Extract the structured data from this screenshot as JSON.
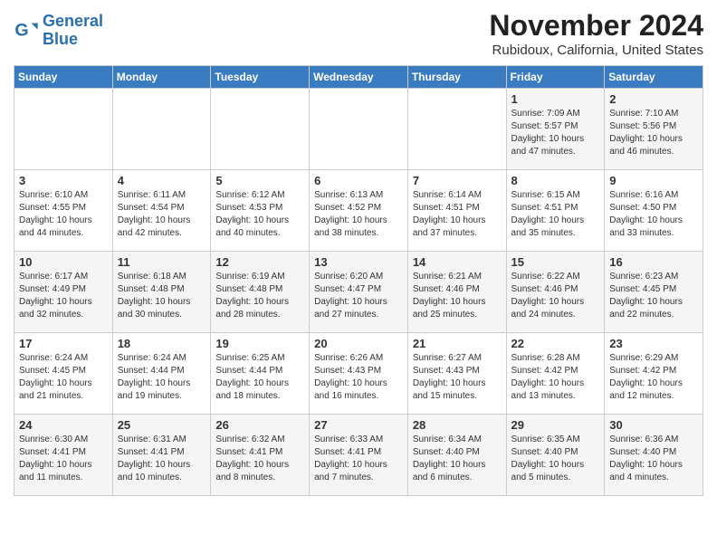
{
  "logo": {
    "line1": "General",
    "line2": "Blue"
  },
  "title": "November 2024",
  "location": "Rubidoux, California, United States",
  "days_of_week": [
    "Sunday",
    "Monday",
    "Tuesday",
    "Wednesday",
    "Thursday",
    "Friday",
    "Saturday"
  ],
  "weeks": [
    [
      {
        "day": "",
        "content": ""
      },
      {
        "day": "",
        "content": ""
      },
      {
        "day": "",
        "content": ""
      },
      {
        "day": "",
        "content": ""
      },
      {
        "day": "",
        "content": ""
      },
      {
        "day": "1",
        "content": "Sunrise: 7:09 AM\nSunset: 5:57 PM\nDaylight: 10 hours and 47 minutes."
      },
      {
        "day": "2",
        "content": "Sunrise: 7:10 AM\nSunset: 5:56 PM\nDaylight: 10 hours and 46 minutes."
      }
    ],
    [
      {
        "day": "3",
        "content": "Sunrise: 6:10 AM\nSunset: 4:55 PM\nDaylight: 10 hours and 44 minutes."
      },
      {
        "day": "4",
        "content": "Sunrise: 6:11 AM\nSunset: 4:54 PM\nDaylight: 10 hours and 42 minutes."
      },
      {
        "day": "5",
        "content": "Sunrise: 6:12 AM\nSunset: 4:53 PM\nDaylight: 10 hours and 40 minutes."
      },
      {
        "day": "6",
        "content": "Sunrise: 6:13 AM\nSunset: 4:52 PM\nDaylight: 10 hours and 38 minutes."
      },
      {
        "day": "7",
        "content": "Sunrise: 6:14 AM\nSunset: 4:51 PM\nDaylight: 10 hours and 37 minutes."
      },
      {
        "day": "8",
        "content": "Sunrise: 6:15 AM\nSunset: 4:51 PM\nDaylight: 10 hours and 35 minutes."
      },
      {
        "day": "9",
        "content": "Sunrise: 6:16 AM\nSunset: 4:50 PM\nDaylight: 10 hours and 33 minutes."
      }
    ],
    [
      {
        "day": "10",
        "content": "Sunrise: 6:17 AM\nSunset: 4:49 PM\nDaylight: 10 hours and 32 minutes."
      },
      {
        "day": "11",
        "content": "Sunrise: 6:18 AM\nSunset: 4:48 PM\nDaylight: 10 hours and 30 minutes."
      },
      {
        "day": "12",
        "content": "Sunrise: 6:19 AM\nSunset: 4:48 PM\nDaylight: 10 hours and 28 minutes."
      },
      {
        "day": "13",
        "content": "Sunrise: 6:20 AM\nSunset: 4:47 PM\nDaylight: 10 hours and 27 minutes."
      },
      {
        "day": "14",
        "content": "Sunrise: 6:21 AM\nSunset: 4:46 PM\nDaylight: 10 hours and 25 minutes."
      },
      {
        "day": "15",
        "content": "Sunrise: 6:22 AM\nSunset: 4:46 PM\nDaylight: 10 hours and 24 minutes."
      },
      {
        "day": "16",
        "content": "Sunrise: 6:23 AM\nSunset: 4:45 PM\nDaylight: 10 hours and 22 minutes."
      }
    ],
    [
      {
        "day": "17",
        "content": "Sunrise: 6:24 AM\nSunset: 4:45 PM\nDaylight: 10 hours and 21 minutes."
      },
      {
        "day": "18",
        "content": "Sunrise: 6:24 AM\nSunset: 4:44 PM\nDaylight: 10 hours and 19 minutes."
      },
      {
        "day": "19",
        "content": "Sunrise: 6:25 AM\nSunset: 4:44 PM\nDaylight: 10 hours and 18 minutes."
      },
      {
        "day": "20",
        "content": "Sunrise: 6:26 AM\nSunset: 4:43 PM\nDaylight: 10 hours and 16 minutes."
      },
      {
        "day": "21",
        "content": "Sunrise: 6:27 AM\nSunset: 4:43 PM\nDaylight: 10 hours and 15 minutes."
      },
      {
        "day": "22",
        "content": "Sunrise: 6:28 AM\nSunset: 4:42 PM\nDaylight: 10 hours and 13 minutes."
      },
      {
        "day": "23",
        "content": "Sunrise: 6:29 AM\nSunset: 4:42 PM\nDaylight: 10 hours and 12 minutes."
      }
    ],
    [
      {
        "day": "24",
        "content": "Sunrise: 6:30 AM\nSunset: 4:41 PM\nDaylight: 10 hours and 11 minutes."
      },
      {
        "day": "25",
        "content": "Sunrise: 6:31 AM\nSunset: 4:41 PM\nDaylight: 10 hours and 10 minutes."
      },
      {
        "day": "26",
        "content": "Sunrise: 6:32 AM\nSunset: 4:41 PM\nDaylight: 10 hours and 8 minutes."
      },
      {
        "day": "27",
        "content": "Sunrise: 6:33 AM\nSunset: 4:41 PM\nDaylight: 10 hours and 7 minutes."
      },
      {
        "day": "28",
        "content": "Sunrise: 6:34 AM\nSunset: 4:40 PM\nDaylight: 10 hours and 6 minutes."
      },
      {
        "day": "29",
        "content": "Sunrise: 6:35 AM\nSunset: 4:40 PM\nDaylight: 10 hours and 5 minutes."
      },
      {
        "day": "30",
        "content": "Sunrise: 6:36 AM\nSunset: 4:40 PM\nDaylight: 10 hours and 4 minutes."
      }
    ]
  ]
}
